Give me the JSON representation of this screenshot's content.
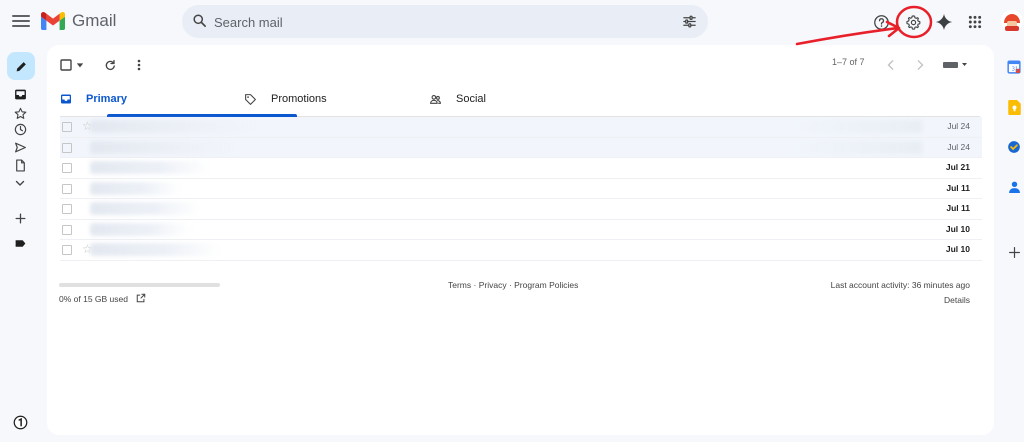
{
  "app": {
    "brand": "Gmail"
  },
  "search": {
    "placeholder": "Search mail"
  },
  "toolbar": {
    "pager_text": "1–7 of 7"
  },
  "tabs": [
    {
      "label": "Primary",
      "icon": "inbox-icon",
      "active": true
    },
    {
      "label": "Promotions",
      "icon": "tag-icon",
      "active": false
    },
    {
      "label": "Social",
      "icon": "people-icon",
      "active": false
    }
  ],
  "emails": [
    {
      "date": "Jul 24",
      "read": true
    },
    {
      "date": "Jul 24",
      "read": true
    },
    {
      "date": "Jul 21",
      "read": false
    },
    {
      "date": "Jul 11",
      "read": false
    },
    {
      "date": "Jul 11",
      "read": false
    },
    {
      "date": "Jul 10",
      "read": false
    },
    {
      "date": "Jul 10",
      "read": false
    }
  ],
  "footer": {
    "storage_text": "0% of 15 GB used",
    "storage_percent": 0,
    "terms": "Terms",
    "privacy": "Privacy",
    "program_policies": "Program Policies",
    "activity": "Last account activity: 36 minutes ago",
    "details": "Details"
  },
  "colors": {
    "accent": "#0b57d0",
    "annotation": "#e8202a",
    "compose_bg": "#c2e7ff"
  }
}
